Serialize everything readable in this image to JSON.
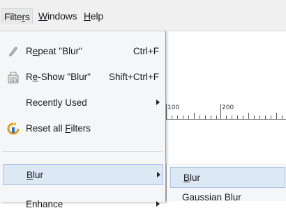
{
  "menubar": {
    "items": [
      {
        "pre": "Filte",
        "key": "r",
        "post": "s"
      },
      {
        "pre": "",
        "key": "W",
        "post": "indows"
      },
      {
        "pre": "",
        "key": "H",
        "post": "elp"
      }
    ]
  },
  "ruler": {
    "labels": [
      "100",
      "200"
    ]
  },
  "filters_menu": {
    "repeat": {
      "pre": "R",
      "key": "e",
      "post": "peat \"Blur\"",
      "shortcut": "Ctrl+F",
      "icon": "repeat-filter-icon"
    },
    "reshow": {
      "pre": "R",
      "key": "e",
      "post": "-Show \"Blur\"",
      "shortcut": "Shift+Ctrl+F",
      "icon": "reshow-filter-icon"
    },
    "recent": {
      "label": "Recently Used"
    },
    "reset": {
      "pre": "Reset all ",
      "key": "F",
      "post": "ilters",
      "icon": "reset-filters-icon"
    },
    "blur": {
      "pre": "",
      "key": "B",
      "post": "lur"
    },
    "next_partial": {
      "label": "Enhance"
    }
  },
  "blur_submenu": {
    "blur": {
      "pre": "",
      "key": "B",
      "post": "lur"
    },
    "next_partial": {
      "label": "Gaussian Blur"
    }
  }
}
